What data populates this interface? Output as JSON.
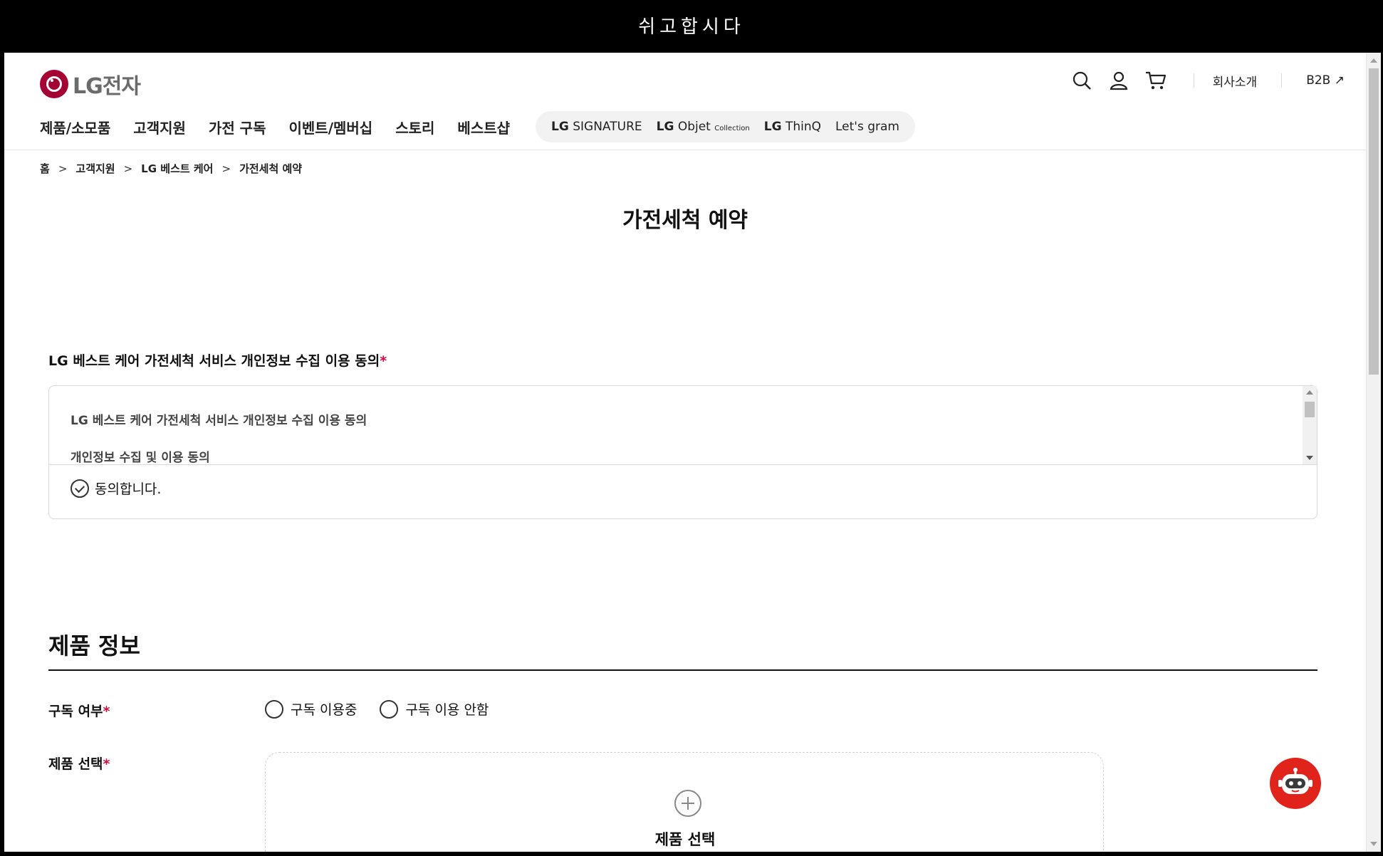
{
  "window_title": "쉬고합시다",
  "header": {
    "logo_text": "LG전자",
    "utility_links": [
      "회사소개",
      "B2B ↗"
    ],
    "icons": [
      "search-icon",
      "user-icon",
      "cart-icon"
    ]
  },
  "nav": {
    "items": [
      "제품/소모품",
      "고객지원",
      "가전 구독",
      "이벤트/멤버십",
      "스토리",
      "베스트샵"
    ],
    "brands": {
      "signature_prefix": "LG",
      "signature": "SIGNATURE",
      "objet_prefix": "LG",
      "objet": "Objet",
      "objet_suffix": "Collection",
      "thinq_prefix": "LG",
      "thinq": "ThinQ",
      "gram": "Let's gram"
    }
  },
  "breadcrumb": [
    "홈",
    "고객지원",
    "LG 베스트 케어",
    "가전세척 예약"
  ],
  "page_title": "가전세척 예약",
  "consent": {
    "title": "LG 베스트 케어 가전세척 서비스 개인정보 수집 이용 동의",
    "required_mark": "*",
    "terms_line1": "LG 베스트 케어 가전세척 서비스 개인정보 수집 이용 동의",
    "terms_line2": "개인정보 수집 및 이용 동의",
    "agree_label": "동의합니다."
  },
  "product_info": {
    "section_title": "제품 정보",
    "subscription_label": "구독 여부",
    "subscription_options": [
      "구독 이용중",
      "구독 이용 안함"
    ],
    "product_select_label": "제품 선택",
    "product_select_button": "제품 선택",
    "required_mark": "*"
  },
  "colors": {
    "brand": "#a50034",
    "required": "#d90b3e",
    "chatbot": "#e0241c"
  }
}
